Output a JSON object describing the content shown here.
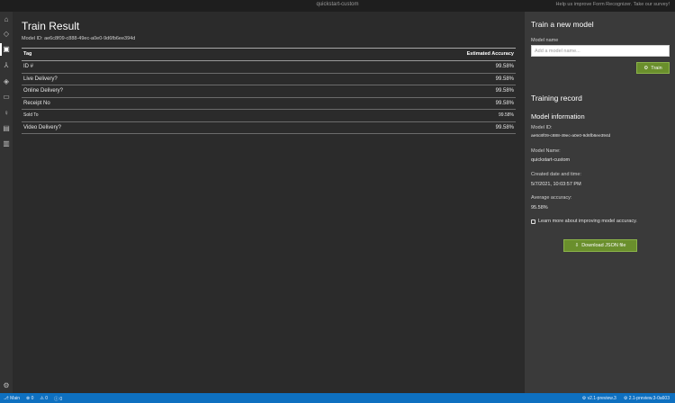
{
  "window": {
    "title": "quickstart-custom",
    "help_text": "Help us improve Form Recognizer. Take our survey!"
  },
  "activity_bar": {
    "icons": [
      "home-icon",
      "tag-icon",
      "train-icon",
      "merge-icon",
      "shield-icon",
      "document-icon",
      "lightbulb-icon",
      "id-card-icon",
      "doc-list-icon",
      "settings-icon"
    ],
    "active": "train-icon"
  },
  "main": {
    "title": "Train Result",
    "model_id_text": "Model ID: ae6c8f09-c888-49ec-a0e0-9d6fb6ee394d",
    "columns": [
      "Tag",
      "Estimated Accuracy"
    ],
    "rows": [
      {
        "tag": "ID #",
        "accuracy": "99.58%"
      },
      {
        "tag": "Live Delivery?",
        "accuracy": "99.58%"
      },
      {
        "tag": "Online Delivery?",
        "accuracy": "99.58%"
      },
      {
        "tag": "Receipt No",
        "accuracy": "99.58%"
      },
      {
        "tag": "Sold To",
        "accuracy": "99.58%"
      },
      {
        "tag": "Video Delivery?",
        "accuracy": "99.58%"
      }
    ]
  },
  "side": {
    "new_model_heading": "Train a new model",
    "model_name_label": "Model name",
    "model_name_placeholder": "Add a model name...",
    "train_button": "Train",
    "training_record_heading": "Training record",
    "model_info_heading": "Model information",
    "model_id_label": "Model ID:",
    "model_id_value": "ae6c8f09-c888-49ec-a0e0-9d6fb6ee394d",
    "model_name_field_label": "Model Name:",
    "model_name_value": "quickstart-custom",
    "created_label": "Created date and time:",
    "created_value": "5/7/2021, 10:03:57 PM",
    "avg_label": "Average accuracy:",
    "avg_value": "95.58%",
    "hint_text": "Learn more about improving model accuracy.",
    "download_button": "Download JSON file"
  },
  "statusbar": {
    "left": [
      "Main",
      "0",
      "0",
      "0"
    ],
    "right": [
      "v2.1-preview.3",
      "2.1-preview.3-0a603"
    ]
  },
  "colors": {
    "accent_green": "#6a8f2c",
    "status_blue": "#0e70c0"
  }
}
